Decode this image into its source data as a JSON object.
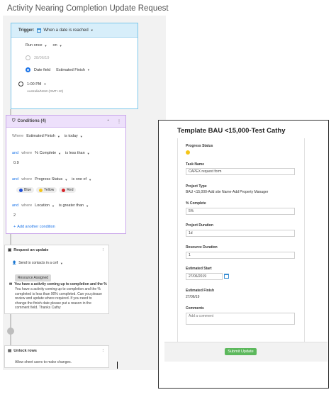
{
  "page_title": "Activity Nearing Completion Update Request",
  "trigger": {
    "label": "Trigger:",
    "event": "When a date is reached",
    "frequency": "Run once",
    "on": "on",
    "date_value": "28/06/19",
    "date_field_label": "Date field",
    "date_field_value": "Estimated Finish",
    "time": "1:00 PM",
    "timezone": "Australia/NSW (GMT+10)"
  },
  "conditions": {
    "title": "Conditions (4)",
    "where": "Where",
    "and": "and",
    "and_where": "where",
    "c1": {
      "field": "Estimated Finish",
      "op": "is today"
    },
    "c2": {
      "field": "% Complete",
      "op": "is less than",
      "value": "0.9"
    },
    "c3": {
      "field": "Progress Status",
      "op": "is one of",
      "pills": [
        "Blue",
        "Yellow",
        "Red"
      ]
    },
    "c4": {
      "field": "Location",
      "op": "is greater than",
      "value": "2"
    },
    "add_condition": "Add another condition"
  },
  "request": {
    "title": "Request an update",
    "send_to": "Send to contacts in a cell",
    "cell": "Resource Assigned",
    "subject": "You have a activity coming up to completion and the %",
    "body": "You have a activity coming up to completion and the % completed is less than 90% completed. Can you please review and update where required. If you need to change the finish date please put a reason in the comment field. Thanks Cathy"
  },
  "unlock": {
    "title": "Unlock rows",
    "desc": "Allow sheet users to make changes."
  },
  "form": {
    "title": "Template BAU <15,000-Test Cathy",
    "progress_status_label": "Progress Status",
    "task_name_label": "Task Name",
    "task_name_value": "CAPEX request form",
    "project_type_label": "Project Type",
    "project_type_value": "BAU <15,000-Add site Name-Add Property Manager",
    "pct_complete_label": "% Complete",
    "pct_complete_value": "5%",
    "project_duration_label": "Project Duration",
    "project_duration_value": "1d",
    "resource_duration_label": "Resource Duration",
    "resource_duration_value": "1",
    "estimated_start_label": "Estimated Start",
    "estimated_start_value": "27/06/2019",
    "estimated_finish_label": "Estimated Finish",
    "estimated_finish_value": "27/06/19",
    "comments_label": "Comments",
    "comments_placeholder": "Add a comment",
    "submit_label": "Submit Update"
  },
  "colors": {
    "trigger_accent": "#7cc6ea",
    "conditions_accent": "#c9a6ea",
    "link_blue": "#1a73e8",
    "submit_green": "#5cb85c",
    "status_yellow": "#f5c518"
  }
}
